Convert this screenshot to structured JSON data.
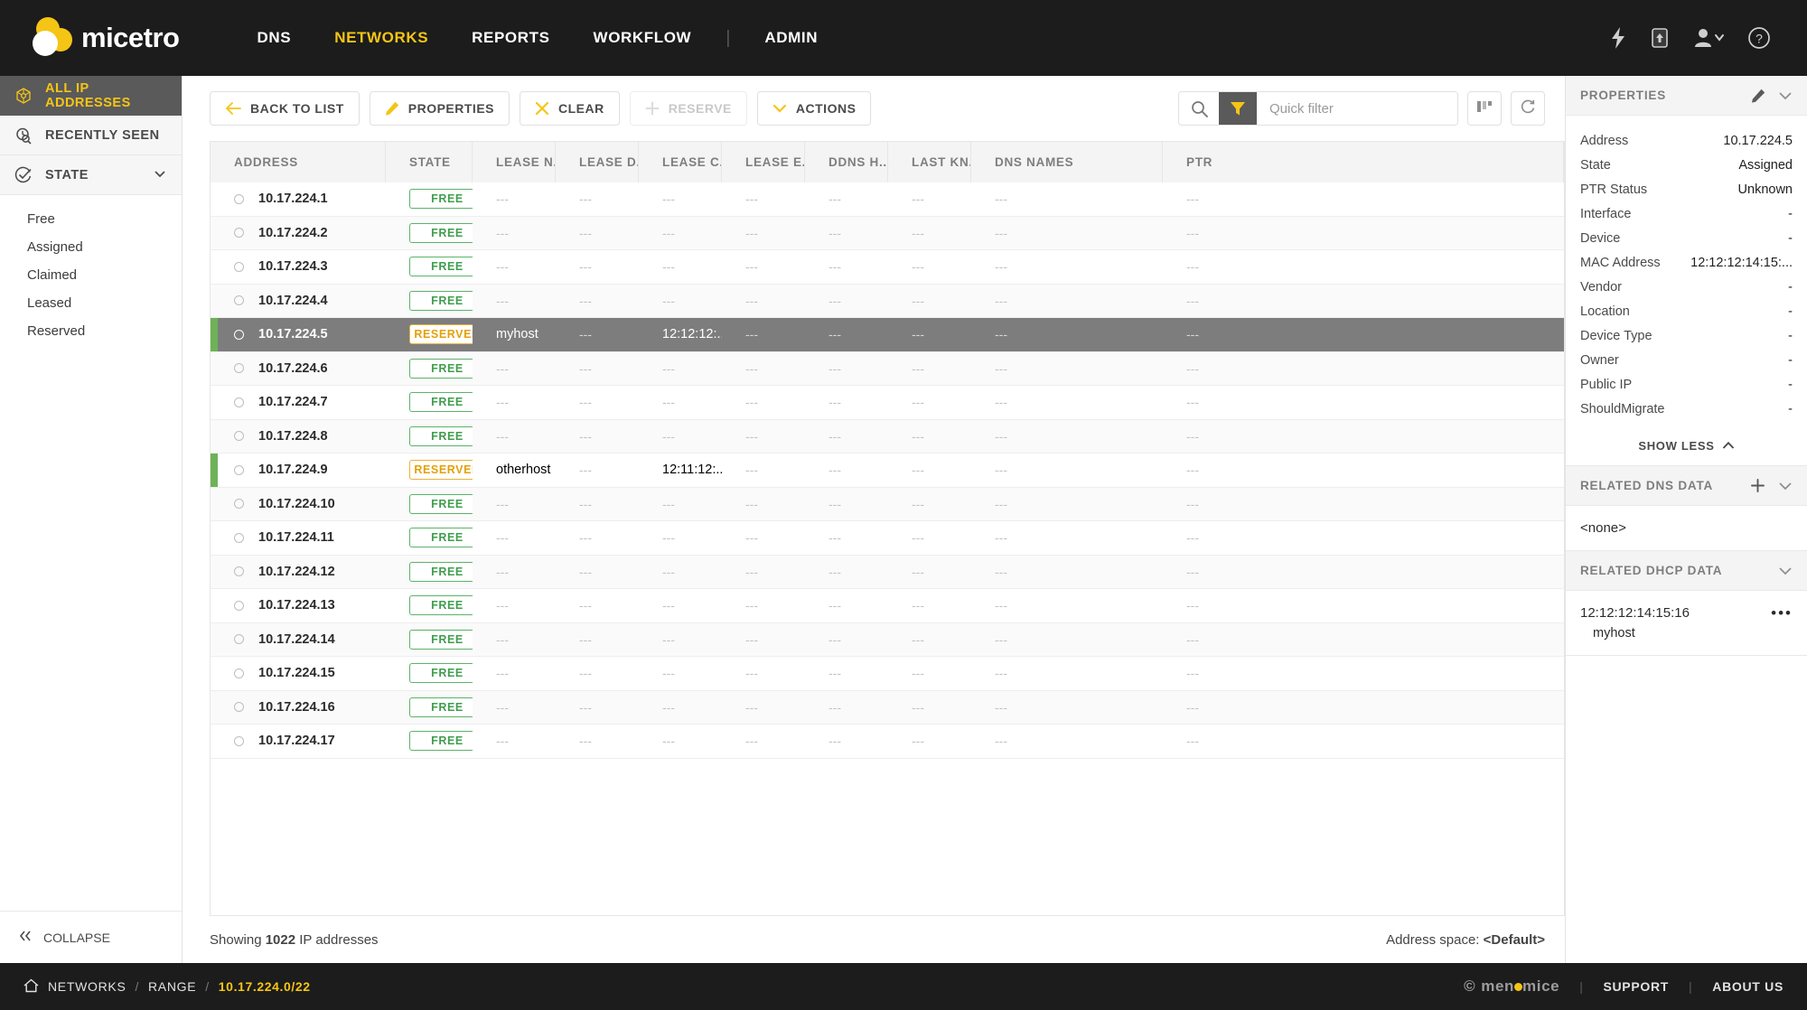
{
  "header": {
    "logo_text": "micetro",
    "nav": [
      {
        "label": "DNS",
        "active": false
      },
      {
        "label": "NETWORKS",
        "active": true
      },
      {
        "label": "REPORTS",
        "active": false
      },
      {
        "label": "WORKFLOW",
        "active": false
      },
      {
        "label": "ADMIN",
        "active": false
      }
    ],
    "icons": [
      "lightning-bolt-icon",
      "upload-box-icon",
      "user-icon",
      "help-circle-icon"
    ]
  },
  "sidebar": {
    "items": [
      {
        "label": "ALL IP ADDRESSES",
        "icon": "network-graph-icon",
        "selected": true
      },
      {
        "label": "RECENTLY SEEN",
        "icon": "clock-search-icon",
        "selected": false
      },
      {
        "label": "STATE",
        "icon": "check-circle-icon",
        "selected": false
      }
    ],
    "state_options": [
      "Free",
      "Assigned",
      "Claimed",
      "Leased",
      "Reserved"
    ],
    "collapse_label": "COLLAPSE"
  },
  "toolbar": {
    "buttons": [
      {
        "label": "BACK TO LIST",
        "icon": "arrow-left-icon",
        "disabled": false
      },
      {
        "label": "PROPERTIES",
        "icon": "pencil-icon",
        "disabled": false
      },
      {
        "label": "CLEAR",
        "icon": "close-x-icon",
        "disabled": false
      },
      {
        "label": "RESERVE",
        "icon": "plus-icon",
        "disabled": true
      },
      {
        "label": "ACTIONS",
        "icon": "chevron-down-icon",
        "disabled": false
      }
    ],
    "quick_filter_placeholder": "Quick filter",
    "quick_filter_value": "",
    "columns_button": "columns-icon",
    "refresh_button": "refresh-icon"
  },
  "table": {
    "columns": [
      "ADDRESS",
      "STATE",
      "LEASE N...",
      "LEASE D...",
      "LEASE C...",
      "LEASE E...",
      "DDNS H...",
      "LAST KN...",
      "DNS NAMES",
      "PTR"
    ],
    "empty": "---",
    "rows": [
      {
        "address": "10.17.224.1",
        "state": "FREE",
        "lease_name": "---",
        "lease_d": "---",
        "lease_c": "---",
        "lease_e": "---",
        "ddns": "---",
        "last_known": "---",
        "dns_names": "---",
        "ptr": "---",
        "selected": false,
        "marker": false
      },
      {
        "address": "10.17.224.2",
        "state": "FREE",
        "lease_name": "---",
        "lease_d": "---",
        "lease_c": "---",
        "lease_e": "---",
        "ddns": "---",
        "last_known": "---",
        "dns_names": "---",
        "ptr": "---",
        "selected": false,
        "marker": false
      },
      {
        "address": "10.17.224.3",
        "state": "FREE",
        "lease_name": "---",
        "lease_d": "---",
        "lease_c": "---",
        "lease_e": "---",
        "ddns": "---",
        "last_known": "---",
        "dns_names": "---",
        "ptr": "---",
        "selected": false,
        "marker": false
      },
      {
        "address": "10.17.224.4",
        "state": "FREE",
        "lease_name": "---",
        "lease_d": "---",
        "lease_c": "---",
        "lease_e": "---",
        "ddns": "---",
        "last_known": "---",
        "dns_names": "---",
        "ptr": "---",
        "selected": false,
        "marker": false
      },
      {
        "address": "10.17.224.5",
        "state": "RESERVED",
        "lease_name": "myhost",
        "lease_d": "---",
        "lease_c": "12:12:12:...",
        "lease_e": "---",
        "ddns": "---",
        "last_known": "---",
        "dns_names": "---",
        "ptr": "---",
        "selected": true,
        "marker": true
      },
      {
        "address": "10.17.224.6",
        "state": "FREE",
        "lease_name": "---",
        "lease_d": "---",
        "lease_c": "---",
        "lease_e": "---",
        "ddns": "---",
        "last_known": "---",
        "dns_names": "---",
        "ptr": "---",
        "selected": false,
        "marker": false
      },
      {
        "address": "10.17.224.7",
        "state": "FREE",
        "lease_name": "---",
        "lease_d": "---",
        "lease_c": "---",
        "lease_e": "---",
        "ddns": "---",
        "last_known": "---",
        "dns_names": "---",
        "ptr": "---",
        "selected": false,
        "marker": false
      },
      {
        "address": "10.17.224.8",
        "state": "FREE",
        "lease_name": "---",
        "lease_d": "---",
        "lease_c": "---",
        "lease_e": "---",
        "ddns": "---",
        "last_known": "---",
        "dns_names": "---",
        "ptr": "---",
        "selected": false,
        "marker": false
      },
      {
        "address": "10.17.224.9",
        "state": "RESERVED",
        "lease_name": "otherhost",
        "lease_d": "---",
        "lease_c": "12:11:12:...",
        "lease_e": "---",
        "ddns": "---",
        "last_known": "---",
        "dns_names": "---",
        "ptr": "---",
        "selected": false,
        "marker": true
      },
      {
        "address": "10.17.224.10",
        "state": "FREE",
        "lease_name": "---",
        "lease_d": "---",
        "lease_c": "---",
        "lease_e": "---",
        "ddns": "---",
        "last_known": "---",
        "dns_names": "---",
        "ptr": "---",
        "selected": false,
        "marker": false
      },
      {
        "address": "10.17.224.11",
        "state": "FREE",
        "lease_name": "---",
        "lease_d": "---",
        "lease_c": "---",
        "lease_e": "---",
        "ddns": "---",
        "last_known": "---",
        "dns_names": "---",
        "ptr": "---",
        "selected": false,
        "marker": false
      },
      {
        "address": "10.17.224.12",
        "state": "FREE",
        "lease_name": "---",
        "lease_d": "---",
        "lease_c": "---",
        "lease_e": "---",
        "ddns": "---",
        "last_known": "---",
        "dns_names": "---",
        "ptr": "---",
        "selected": false,
        "marker": false
      },
      {
        "address": "10.17.224.13",
        "state": "FREE",
        "lease_name": "---",
        "lease_d": "---",
        "lease_c": "---",
        "lease_e": "---",
        "ddns": "---",
        "last_known": "---",
        "dns_names": "---",
        "ptr": "---",
        "selected": false,
        "marker": false
      },
      {
        "address": "10.17.224.14",
        "state": "FREE",
        "lease_name": "---",
        "lease_d": "---",
        "lease_c": "---",
        "lease_e": "---",
        "ddns": "---",
        "last_known": "---",
        "dns_names": "---",
        "ptr": "---",
        "selected": false,
        "marker": false
      },
      {
        "address": "10.17.224.15",
        "state": "FREE",
        "lease_name": "---",
        "lease_d": "---",
        "lease_c": "---",
        "lease_e": "---",
        "ddns": "---",
        "last_known": "---",
        "dns_names": "---",
        "ptr": "---",
        "selected": false,
        "marker": false
      },
      {
        "address": "10.17.224.16",
        "state": "FREE",
        "lease_name": "---",
        "lease_d": "---",
        "lease_c": "---",
        "lease_e": "---",
        "ddns": "---",
        "last_known": "---",
        "dns_names": "---",
        "ptr": "---",
        "selected": false,
        "marker": false
      },
      {
        "address": "10.17.224.17",
        "state": "FREE",
        "lease_name": "---",
        "lease_d": "---",
        "lease_c": "---",
        "lease_e": "---",
        "ddns": "---",
        "last_known": "---",
        "dns_names": "---",
        "ptr": "---",
        "selected": false,
        "marker": false
      }
    ]
  },
  "status": {
    "showing_prefix": "Showing ",
    "count": "1022",
    "showing_suffix": " IP addresses",
    "address_space_label": "Address space: ",
    "address_space_value": "<Default>"
  },
  "properties_panel": {
    "title": "PROPERTIES",
    "edit_icon": "pencil-icon",
    "collapse_icon": "chevron-down-icon",
    "rows": [
      {
        "key": "Address",
        "value": "10.17.224.5"
      },
      {
        "key": "State",
        "value": "Assigned"
      },
      {
        "key": "PTR Status",
        "value": "Unknown"
      },
      {
        "key": "Interface",
        "value": "-"
      },
      {
        "key": "Device",
        "value": "-"
      },
      {
        "key": "MAC Address",
        "value": "12:12:12:14:15:..."
      },
      {
        "key": "Vendor",
        "value": "-"
      },
      {
        "key": "Location",
        "value": "-"
      },
      {
        "key": "Device Type",
        "value": "-"
      },
      {
        "key": "Owner",
        "value": "-"
      },
      {
        "key": "Public IP",
        "value": "-"
      },
      {
        "key": "ShouldMigrate",
        "value": "-"
      }
    ],
    "show_less": "SHOW LESS"
  },
  "related_dns": {
    "title": "RELATED DNS DATA",
    "add_icon": "plus-icon",
    "collapse_icon": "chevron-down-icon",
    "content": "<none>"
  },
  "related_dhcp": {
    "title": "RELATED DHCP DATA",
    "collapse_icon": "chevron-down-icon",
    "items": [
      {
        "mac": "12:12:12:14:15:16",
        "host": "myhost",
        "menu": "•••"
      }
    ]
  },
  "footer": {
    "home_icon": "home-icon",
    "breadcrumb": [
      {
        "label": "NETWORKS",
        "current": false
      },
      {
        "label": "RANGE",
        "current": false
      },
      {
        "label": "10.17.224.0/22",
        "current": true
      }
    ],
    "separator": "/",
    "brand": "menmice",
    "copyright": "©",
    "links": [
      "SUPPORT",
      "ABOUT US"
    ],
    "link_separator": "|"
  },
  "colors": {
    "accent": "#f5c516",
    "dark": "#1c1c1c",
    "free_green": "#5bb36a",
    "reserved_orange": "#e8b33a",
    "row_selected": "#7d7d7d",
    "marker_green": "#6eb257"
  }
}
